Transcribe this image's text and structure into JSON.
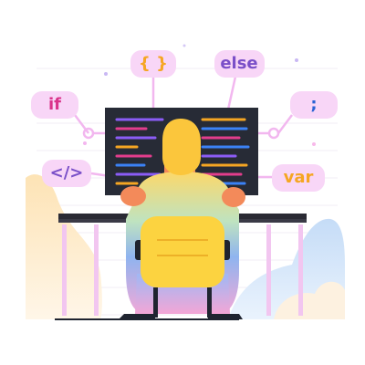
{
  "tags": {
    "braces": "{ }",
    "else": "else",
    "if": "if",
    "semicolon": ";",
    "html": "</>",
    "var": "var"
  },
  "colors": {
    "bubble": "#f8d6f7",
    "connector": "#f2b7ef",
    "tag_orange": "#f5a623",
    "tag_purple": "#7a4fc8",
    "tag_pink": "#d9338a",
    "tag_blue": "#2a62d4",
    "monitor": "#272b36",
    "head": "#fbc63c",
    "chair": "#fcd340",
    "desk": "#2a2a34"
  }
}
